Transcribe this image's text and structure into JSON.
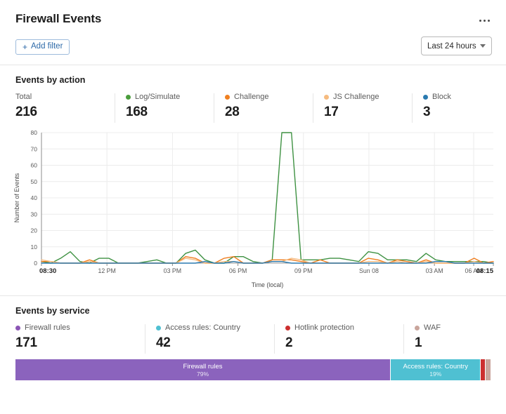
{
  "header": {
    "title": "Firewall Events",
    "kebab_icon": "more-horizontal-icon",
    "add_filter_label": "Add filter",
    "add_filter_plus": "+",
    "time_range": {
      "selected": "Last 24 hours",
      "caret_icon": "chevron-down-icon"
    }
  },
  "events_by_action": {
    "section_title": "Events by action",
    "stats": [
      {
        "label": "Total",
        "value": "216",
        "color": null
      },
      {
        "label": "Log/Simulate",
        "value": "168",
        "color": "#4a9d3c"
      },
      {
        "label": "Challenge",
        "value": "28",
        "color": "#f08020"
      },
      {
        "label": "JS Challenge",
        "value": "17",
        "color": "#f6bb7f"
      },
      {
        "label": "Block",
        "value": "3",
        "color": "#2a7ab0"
      }
    ]
  },
  "chart_data": {
    "type": "line",
    "title": "",
    "xlabel": "Time (local)",
    "ylabel": "Number of Events",
    "ylim": [
      0,
      80
    ],
    "yticks": [
      0,
      10,
      20,
      30,
      40,
      50,
      60,
      70,
      80
    ],
    "xticks": [
      "08:30",
      "12 PM",
      "03 PM",
      "06 PM",
      "09 PM",
      "Sun 08",
      "03 AM",
      "06 AM",
      "08:15"
    ],
    "xtick_positions": [
      0,
      0.1449,
      0.2899,
      0.4348,
      0.5797,
      0.7246,
      0.8696,
      0.9565,
      1.0
    ],
    "grid": true,
    "legend_position": "top",
    "x_count": 48,
    "series": [
      {
        "name": "Log/Simulate",
        "color": "#3e9142",
        "values": [
          1,
          0,
          3,
          7,
          1,
          0,
          3,
          3,
          0,
          0,
          0,
          1,
          2,
          0,
          0,
          6,
          8,
          2,
          0,
          0,
          4,
          4,
          1,
          0,
          2,
          80,
          80,
          2,
          2,
          2,
          3,
          3,
          2,
          1,
          7,
          6,
          2,
          2,
          2,
          1,
          6,
          2,
          1,
          1,
          1,
          1,
          1,
          0
        ]
      },
      {
        "name": "Challenge",
        "color": "#ef7e1f",
        "values": [
          1,
          1,
          0,
          0,
          0,
          2,
          0,
          0,
          0,
          0,
          0,
          0,
          0,
          0,
          0,
          4,
          3,
          0,
          0,
          3,
          4,
          0,
          0,
          0,
          2,
          2,
          2,
          1,
          0,
          2,
          0,
          0,
          0,
          0,
          3,
          2,
          0,
          2,
          1,
          0,
          2,
          0,
          0,
          0,
          0,
          3,
          0,
          1
        ]
      },
      {
        "name": "JS Challenge",
        "color": "#f6bb7f",
        "values": [
          2,
          1,
          0,
          0,
          0,
          1,
          0,
          0,
          0,
          0,
          0,
          0,
          0,
          0,
          0,
          3,
          2,
          0,
          0,
          1,
          1,
          0,
          0,
          0,
          1,
          1,
          3,
          2,
          0,
          0,
          0,
          0,
          0,
          0,
          1,
          1,
          0,
          1,
          0,
          0,
          1,
          0,
          0,
          0,
          0,
          1,
          0,
          0
        ]
      },
      {
        "name": "Block",
        "color": "#2a7ab0",
        "values": [
          0,
          0,
          0,
          0,
          0,
          0,
          0,
          0,
          0,
          0,
          0,
          0,
          0,
          0,
          0,
          0,
          0,
          1,
          0,
          0,
          1,
          0,
          0,
          0,
          1,
          1,
          0,
          0,
          0,
          0,
          0,
          0,
          0,
          0,
          0,
          0,
          0,
          0,
          0,
          0,
          0,
          1,
          1,
          0,
          0,
          0,
          0,
          0
        ]
      }
    ]
  },
  "events_by_service": {
    "section_title": "Events by service",
    "stats": [
      {
        "label": "Firewall rules",
        "value": "171",
        "color": "#8b55b5"
      },
      {
        "label": "Access rules: Country",
        "value": "42",
        "color": "#4fc0d2"
      },
      {
        "label": "Hotlink protection",
        "value": "2",
        "color": "#cc2f2f"
      },
      {
        "label": "WAF",
        "value": "1",
        "color": "#c9a59c"
      }
    ],
    "bar": [
      {
        "name": "Firewall rules",
        "pct": "79%",
        "width": 79.0,
        "color": "#8b63bd",
        "show_label": true
      },
      {
        "name": "Access rules: Country",
        "pct": "19%",
        "width": 19.0,
        "color": "#4fc0d2",
        "show_label": true
      },
      {
        "name": "Hotlink protection",
        "pct": "1%",
        "width": 1.0,
        "color": "#cc2f2f",
        "show_label": false
      },
      {
        "name": "WAF",
        "pct": "0%",
        "width": 1.0,
        "color": "#c9a59c",
        "show_label": false
      }
    ]
  }
}
